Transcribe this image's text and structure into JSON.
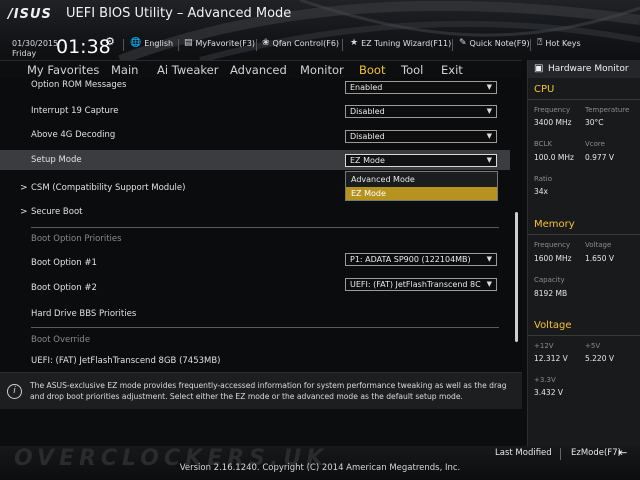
{
  "header": {
    "logo": "/ISUS",
    "title": "UEFI BIOS Utility – Advanced Mode",
    "date": "01/30/2015",
    "day": "Friday",
    "time": "01:38",
    "settings_icon": "gear-icon",
    "links": [
      {
        "label": "English",
        "icon": "globe-icon"
      },
      {
        "label": "MyFavorite(F3)",
        "icon": "favorite-icon"
      },
      {
        "label": "Qfan Control(F6)",
        "icon": "fan-icon"
      },
      {
        "label": "EZ Tuning Wizard(F11)",
        "icon": "wizard-icon"
      },
      {
        "label": "Quick Note(F9)",
        "icon": "note-icon"
      },
      {
        "label": "Hot Keys",
        "icon": "help-icon"
      }
    ]
  },
  "menu": {
    "tabs": [
      "My Favorites",
      "Main",
      "Ai Tweaker",
      "Advanced",
      "Monitor",
      "Boot",
      "Tool",
      "Exit"
    ],
    "active": "Boot"
  },
  "settings": {
    "option_rom": {
      "label": "Option ROM Messages",
      "value": "Enabled"
    },
    "interrupt19": {
      "label": "Interrupt 19 Capture",
      "value": "Disabled"
    },
    "above4g": {
      "label": "Above 4G Decoding",
      "value": "Disabled"
    },
    "setup_mode": {
      "label": "Setup Mode",
      "value": "EZ Mode",
      "options": [
        "Advanced Mode",
        "EZ Mode"
      ]
    },
    "csm": "CSM (Compatibility Support Module)",
    "secure_boot": "Secure Boot",
    "boot_priorities_header": "Boot Option Priorities",
    "boot1": {
      "label": "Boot Option #1",
      "value": "P1: ADATA SP900  (122104MB)"
    },
    "boot2": {
      "label": "Boot Option #2",
      "value": "UEFI: (FAT) JetFlashTranscend 8C"
    },
    "hdd_bbs": "Hard Drive BBS Priorities",
    "boot_override_header": "Boot Override",
    "override1": "UEFI: (FAT) JetFlashTranscend 8GB (7453MB)"
  },
  "help": {
    "text": "The ASUS-exclusive EZ mode provides frequently-accessed information for system performance tweaking as well as the drag and drop boot priorities adjustment. Select either the EZ mode or the advanced mode as the default setup mode."
  },
  "hardware_monitor": {
    "title": "Hardware Monitor",
    "cpu": {
      "title": "CPU",
      "frequency_label": "Frequency",
      "frequency": "3400 MHz",
      "temperature_label": "Temperature",
      "temperature": "30°C",
      "bclk_label": "BCLK",
      "bclk": "100.0 MHz",
      "vcore_label": "Vcore",
      "vcore": "0.977 V",
      "ratio_label": "Ratio",
      "ratio": "34x"
    },
    "memory": {
      "title": "Memory",
      "frequency_label": "Frequency",
      "frequency": "1600 MHz",
      "voltage_label": "Voltage",
      "voltage": "1.650 V",
      "capacity_label": "Capacity",
      "capacity": "8192 MB"
    },
    "voltage": {
      "title": "Voltage",
      "v12_label": "+12V",
      "v12": "12.312 V",
      "v5_label": "+5V",
      "v5": "5.220 V",
      "v33_label": "+3.3V",
      "v33": "3.432 V"
    }
  },
  "footer": {
    "last_modified": "Last Modified",
    "ez_mode": "EzMode(F7)",
    "ez_icon": "exit-arrow-icon",
    "version": "Version 2.16.1240. Copyright (C) 2014 American Megatrends, Inc.",
    "watermark": "OVERCLOCKERS.UK"
  }
}
